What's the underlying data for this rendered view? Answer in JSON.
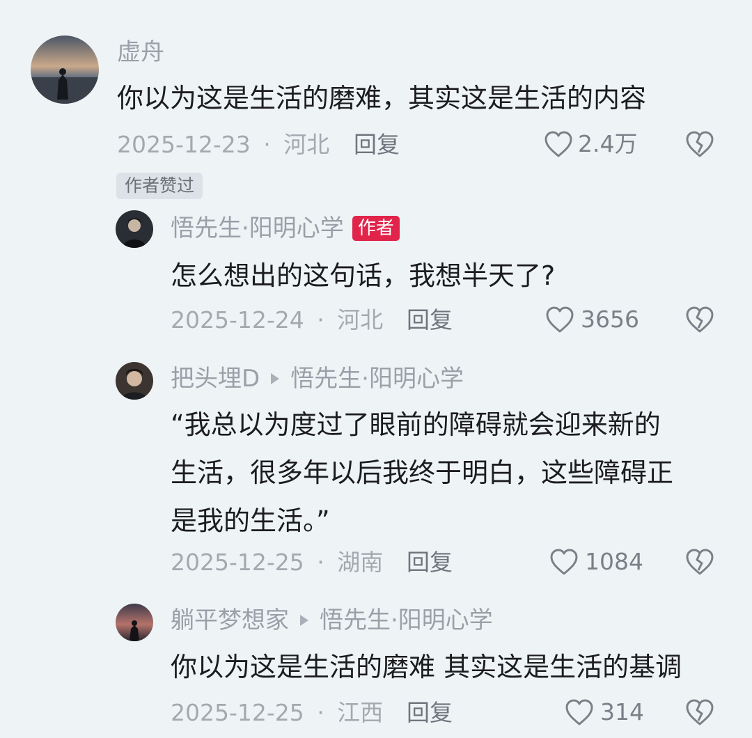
{
  "comments": [
    {
      "name": "虚舟",
      "text": "你以为这是生活的磨难，其实这是生活的内容",
      "date": "2025-12-23",
      "location": "河北",
      "reply_label": "回复",
      "likes": "2.4万",
      "badge": "作者赞过"
    },
    {
      "name": "悟先生·阳明心学",
      "author_tag": "作者",
      "text": "怎么想出的这句话，我想半天了?",
      "date": "2025-12-24",
      "location": "河北",
      "reply_label": "回复",
      "likes": "3656"
    },
    {
      "name": "把头埋D",
      "reply_to": "悟先生·阳明心学",
      "text_lines": [
        "“我总以为度过了眼前的障碍就会迎来新的",
        "生活，很多年以后我终于明白，这些障碍正",
        "是我的生活。”"
      ],
      "date": "2025-12-25",
      "location": "湖南",
      "reply_label": "回复",
      "likes": "1084"
    },
    {
      "name": "躺平梦想家",
      "reply_to": "悟先生·阳明心学",
      "text": "你以为这是生活的磨难 其实这是生活的基调",
      "date": "2025-12-25",
      "location": "江西",
      "reply_label": "回复",
      "likes": "314"
    }
  ],
  "separator": "·",
  "colors": {
    "background": "#eef4f6",
    "author_tag": "#e0244a"
  },
  "icons": {
    "like": "heart-outline-icon",
    "dislike": "broken-heart-icon",
    "reply_arrow": "triangle-right-icon"
  }
}
